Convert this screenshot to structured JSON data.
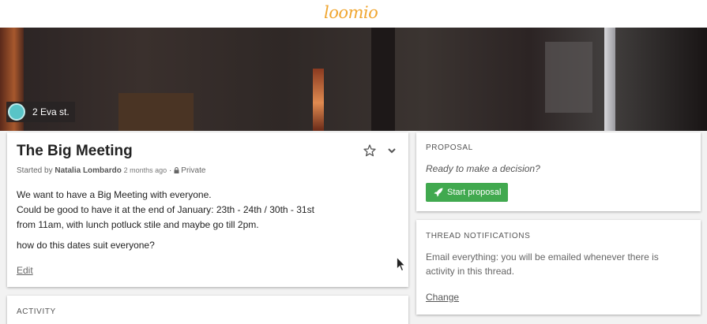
{
  "header": {
    "logo_text": "loomio",
    "logo_color": "#f0a630"
  },
  "group": {
    "name": "2 Eva st.",
    "avatar_color": "#59c4c7"
  },
  "thread": {
    "title": "The Big Meeting",
    "started_by_prefix": "Started by",
    "author": "Natalia Lombardo",
    "time_ago": "2 months ago",
    "privacy": "Private",
    "description_lines": [
      "We want to have a Big Meeting with everyone.",
      "Could be good to have it at the end of January: 23th - 24th / 30th - 31st",
      "from 11am, with lunch potluck stile and maybe go till 2pm."
    ],
    "description_question": "how do this dates suit everyone?",
    "edit_label": "Edit",
    "icons": {
      "star": "star-icon",
      "chevron": "chevron-down-icon",
      "lock": "lock-icon"
    }
  },
  "activity": {
    "label": "ACTIVITY"
  },
  "proposal": {
    "label": "PROPOSAL",
    "prompt": "Ready to make a decision?",
    "button_label": "Start proposal",
    "button_color": "#41a94f",
    "icon": "rocket-icon"
  },
  "notifications": {
    "label": "THREAD NOTIFICATIONS",
    "text": "Email everything: you will be emailed whenever there is activity in this thread.",
    "change_label": "Change"
  }
}
